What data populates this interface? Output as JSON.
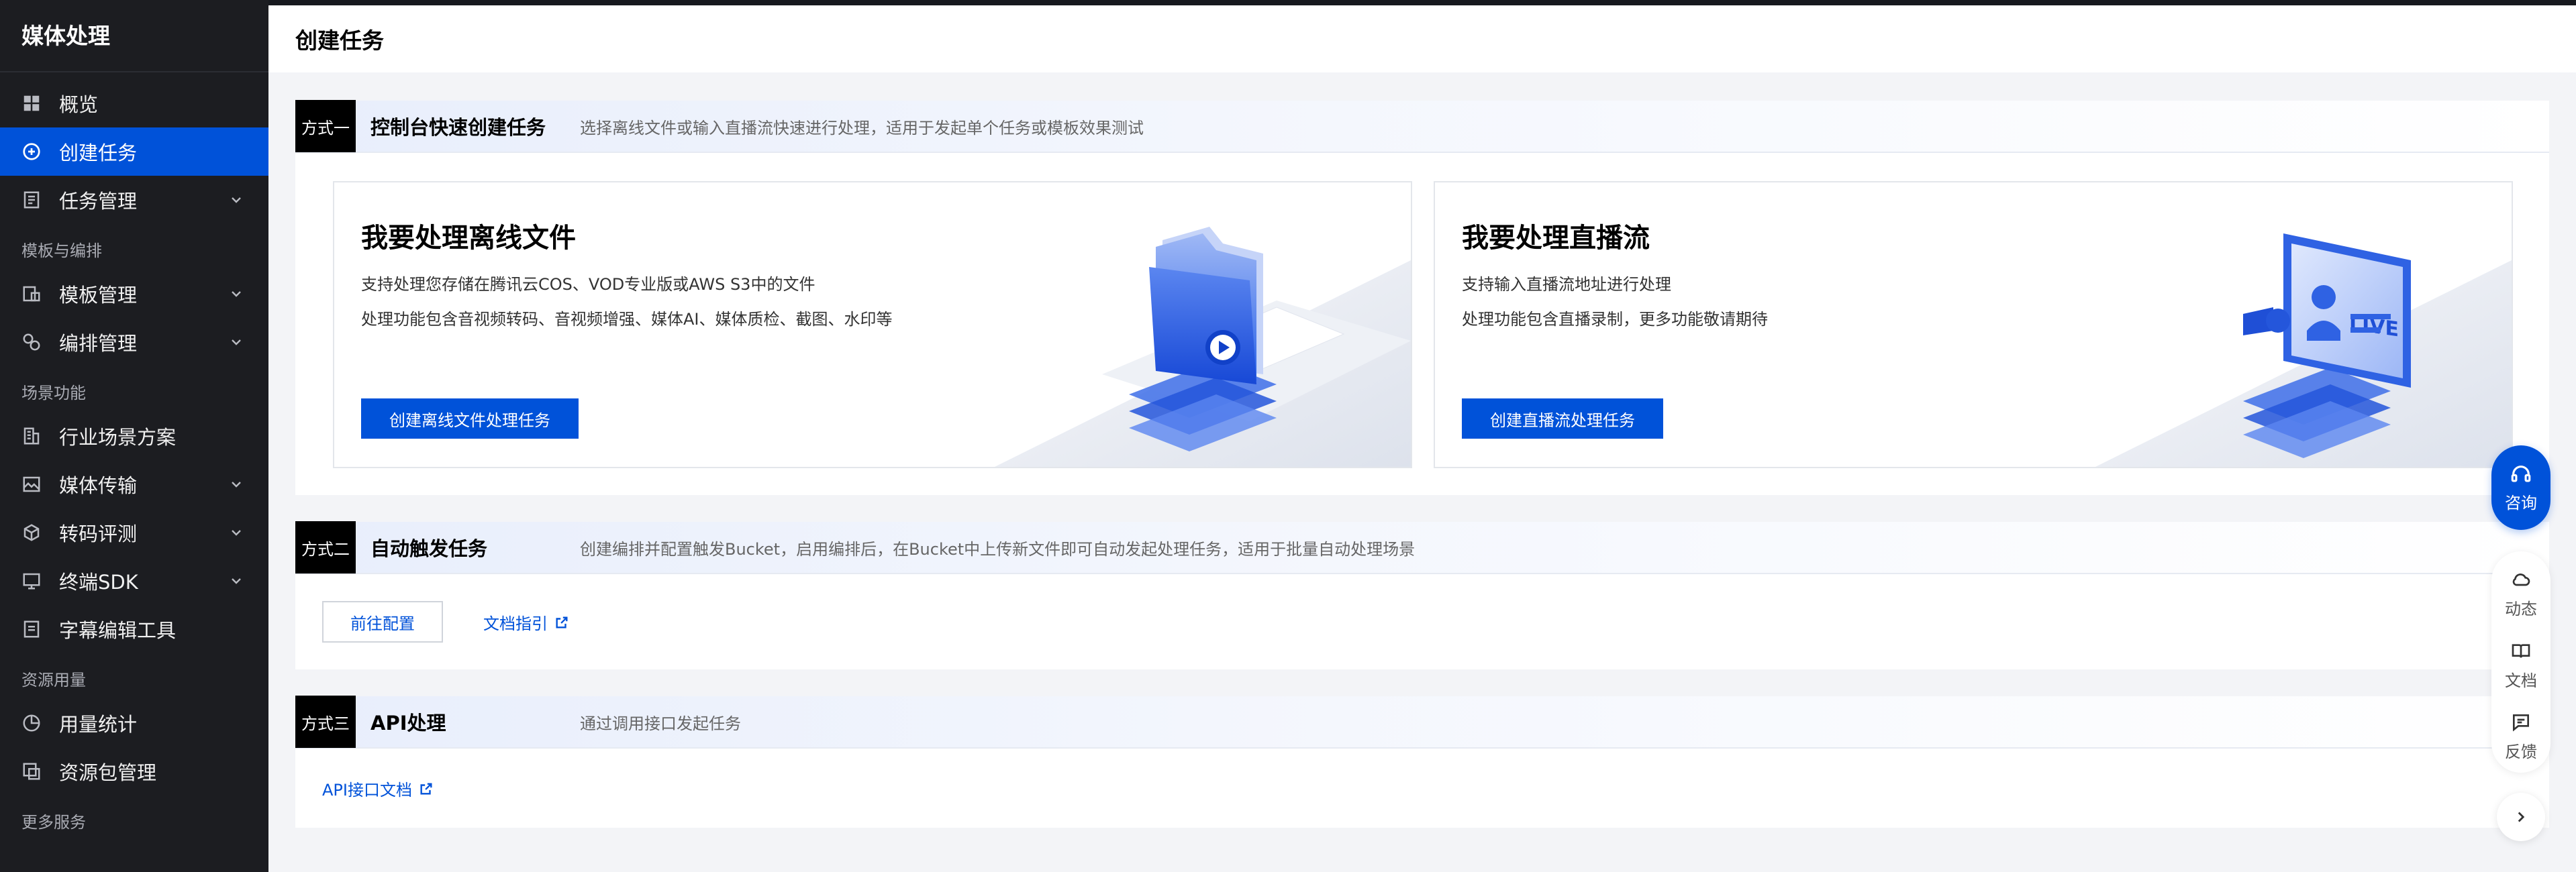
{
  "sidebar": {
    "title": "媒体处理",
    "items": [
      {
        "label": "概览"
      },
      {
        "label": "创建任务"
      },
      {
        "label": "任务管理"
      }
    ],
    "groups": [
      {
        "label": "模板与编排",
        "items": [
          {
            "label": "模板管理"
          },
          {
            "label": "编排管理"
          }
        ]
      },
      {
        "label": "场景功能",
        "items": [
          {
            "label": "行业场景方案"
          },
          {
            "label": "媒体传输"
          },
          {
            "label": "转码评测"
          },
          {
            "label": "终端SDK"
          },
          {
            "label": "字幕编辑工具"
          }
        ]
      },
      {
        "label": "资源用量",
        "items": [
          {
            "label": "用量统计"
          },
          {
            "label": "资源包管理"
          }
        ]
      },
      {
        "label": "更多服务"
      }
    ]
  },
  "header": {
    "title": "创建任务"
  },
  "section1": {
    "tag": "方式一",
    "title": "控制台快速创建任务",
    "desc": "选择离线文件或输入直播流快速进行处理，适用于发起单个任务或模板效果测试",
    "cards": [
      {
        "title": "我要处理离线文件",
        "line1": "支持处理您存储在腾讯云COS、VOD专业版或AWS S3中的文件",
        "line2": "处理功能包含音视频转码、音视频增强、媒体AI、媒体质检、截图、水印等",
        "button": "创建离线文件处理任务"
      },
      {
        "title": "我要处理直播流",
        "line1": "支持输入直播流地址进行处理",
        "line2": "处理功能包含直播录制，更多功能敬请期待",
        "button": "创建直播流处理任务",
        "art_text": "LIVE"
      }
    ]
  },
  "section2": {
    "tag": "方式二",
    "title": "自动触发任务",
    "desc": "创建编排并配置触发Bucket，启用编排后，在Bucket中上传新文件即可自动发起处理任务，适用于批量自动处理场景",
    "button": "前往配置",
    "link": "文档指引"
  },
  "section3": {
    "tag": "方式三",
    "title": "API处理",
    "desc": "通过调用接口发起任务",
    "link": "API接口文档"
  },
  "float": {
    "consult": "咨询",
    "tools": [
      {
        "label": "动态"
      },
      {
        "label": "文档"
      },
      {
        "label": "反馈"
      }
    ]
  },
  "colors": {
    "accent": "#0052d9",
    "sidebar_bg": "#1c1d21"
  }
}
